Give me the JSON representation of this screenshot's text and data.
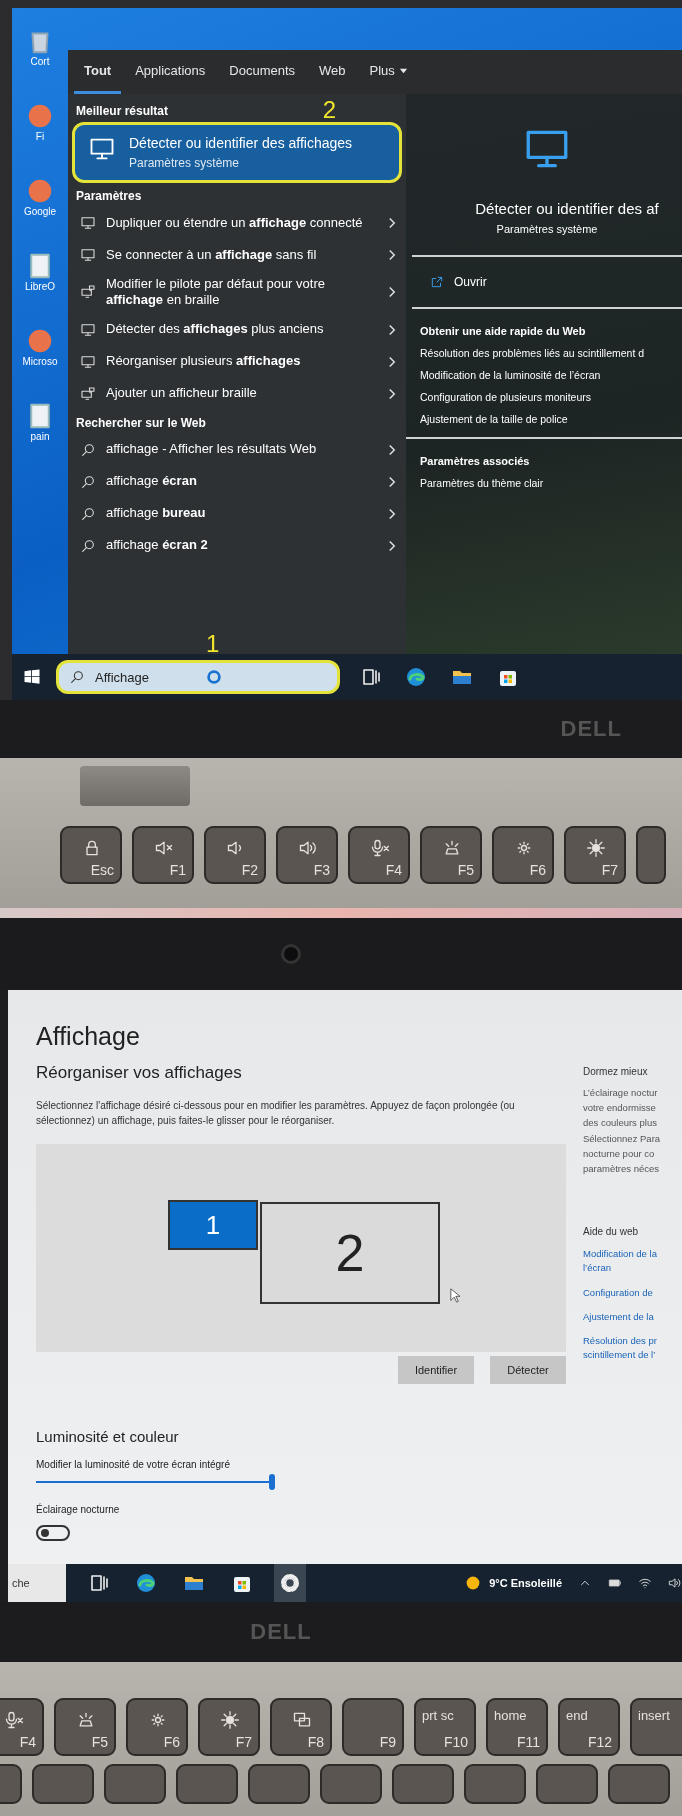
{
  "search_photo": {
    "desktop_icons": [
      {
        "label": "Cort",
        "kind": "bin"
      },
      {
        "label": "Fi",
        "kind": "app"
      },
      {
        "label": "Google",
        "kind": "app"
      },
      {
        "label": "LibreO",
        "kind": "doc"
      },
      {
        "label": "Microso",
        "kind": "app"
      },
      {
        "label": "pain",
        "kind": "doc"
      }
    ],
    "tabs": [
      {
        "label": "Tout",
        "selected": true,
        "has_menu": false
      },
      {
        "label": "Applications",
        "selected": false,
        "has_menu": false
      },
      {
        "label": "Documents",
        "selected": false,
        "has_menu": false
      },
      {
        "label": "Web",
        "selected": false,
        "has_menu": false
      },
      {
        "label": "Plus",
        "selected": false,
        "has_menu": true
      }
    ],
    "best_match_heading": "Meilleur résultat",
    "best_match": {
      "title": "Détecter ou identifier des affichages",
      "subtitle": "Paramètres système",
      "kind": "monitor",
      "selected": true,
      "callout": "2"
    },
    "sections": [
      {
        "heading": "Paramètres",
        "items": [
          {
            "text": "Dupliquer ou étendre un **affichage** connecté",
            "kind": "monitor"
          },
          {
            "text": "Se connecter à un **affichage** sans fil",
            "kind": "monitor"
          },
          {
            "text": "Modifier le pilote par défaut pour votre **affichage** en braille",
            "kind": "braille"
          },
          {
            "text": "Détecter des **affichages** plus anciens",
            "kind": "monitor"
          },
          {
            "text": "Réorganiser plusieurs **affichages**",
            "kind": "monitor"
          },
          {
            "text": "Ajouter un afficheur braille",
            "kind": "braille"
          }
        ]
      },
      {
        "heading": "Rechercher sur le Web",
        "items": [
          {
            "text": "affichage - Afficher les résultats Web",
            "kind": "search"
          },
          {
            "text": "affichage **écran**",
            "kind": "search"
          },
          {
            "text": "affichage **bureau**",
            "kind": "search"
          },
          {
            "text": "affichage **écran 2**",
            "kind": "search"
          }
        ]
      }
    ],
    "preview": {
      "kind": "monitor",
      "title": "Détecter ou identifier des af",
      "subtitle": "Paramètres système",
      "action": {
        "label": "Ouvrir",
        "kind": "open"
      },
      "web_heading": "Obtenir une aide rapide du Web",
      "web_links": [
        "Résolution des problèmes liés au scintillement d",
        "Modification de la luminosité de l’écran",
        "Configuration de plusieurs moniteurs",
        "Ajustement de la taille de police"
      ],
      "related_heading": "Paramètres associés",
      "related_links": [
        "Paramètres du thème clair"
      ]
    },
    "search_box": {
      "value": "Affichage",
      "callout": "1"
    },
    "taskbar_apps": [
      {
        "kind": "taskview",
        "selected": false
      },
      {
        "kind": "edge",
        "selected": false
      },
      {
        "kind": "folder",
        "selected": false
      },
      {
        "kind": "store",
        "selected": false
      }
    ],
    "logo": "DELL",
    "keys": [
      {
        "label": "Esc",
        "kind": "lock"
      },
      {
        "label": "F1",
        "kind": "mute"
      },
      {
        "label": "F2",
        "kind": "voldown"
      },
      {
        "label": "F3",
        "kind": "volup"
      },
      {
        "label": "F4",
        "kind": "micmute"
      },
      {
        "label": "F5",
        "kind": "kblight"
      },
      {
        "label": "F6",
        "kind": "sunsmall"
      },
      {
        "label": "F7",
        "kind": "sun"
      }
    ]
  },
  "settings_photo": {
    "title": "Affichage",
    "section": "Réorganiser vos affichages",
    "description": "Sélectionnez l'affichage désiré ci-dessous pour en modifier les paramètres. Appuyez de façon prolongée (ou sélectionnez) un affichage, puis faites-le glisser pour le réorganiser.",
    "displays": [
      {
        "label": "1",
        "selected": true
      },
      {
        "label": "2",
        "selected": false
      }
    ],
    "buttons": [
      "Identifier",
      "Détecter"
    ],
    "brightness_heading": "Luminosité et couleur",
    "brightness_label": "Modifier la luminosité de votre écran intégré",
    "brightness": {
      "level": 1.0
    },
    "night_light_label": "Éclairage nocturne",
    "night_light": {
      "on": false
    },
    "aside": {
      "heading": "Dormez mieux",
      "text_lines": [
        "L’éclairage noctur",
        "votre endormisse",
        "des couleurs plus",
        "Sélectionnez Para",
        "nocturne pour co",
        "paramètres néces"
      ],
      "help_heading": "Aide du web",
      "links": [
        {
          "lines": [
            "Modification de la",
            "l’écran"
          ]
        },
        {
          "lines": [
            "Configuration de"
          ]
        },
        {
          "lines": [
            "Ajustement de la"
          ]
        },
        {
          "lines": [
            "Résolution des pr",
            "scintillement de l’"
          ]
        }
      ]
    },
    "search_tail": "che",
    "taskbar_apps": [
      {
        "kind": "taskview",
        "selected": false
      },
      {
        "kind": "edge",
        "selected": false
      },
      {
        "kind": "folder",
        "selected": false
      },
      {
        "kind": "store",
        "selected": false
      },
      {
        "kind": "gear",
        "selected": true
      }
    ],
    "weather": "9°C Ensoleillé",
    "tray": [
      {
        "kind": "chevron"
      },
      {
        "kind": "battery"
      },
      {
        "kind": "wifi"
      },
      {
        "kind": "speaker"
      }
    ],
    "logo": "DELL",
    "keys": [
      {
        "label": "F4",
        "kind": "micmute"
      },
      {
        "label": "F5",
        "kind": "kblight"
      },
      {
        "label": "F6",
        "kind": "sunsmall"
      },
      {
        "label": "F7",
        "kind": "sun"
      },
      {
        "label": "F8",
        "kind": "project"
      },
      {
        "label": "F9"
      },
      {
        "top": "prt sc",
        "label": "F10"
      },
      {
        "top": "home",
        "label": "F11"
      },
      {
        "top": "end",
        "label": "F12"
      },
      {
        "top": "insert"
      }
    ]
  }
}
